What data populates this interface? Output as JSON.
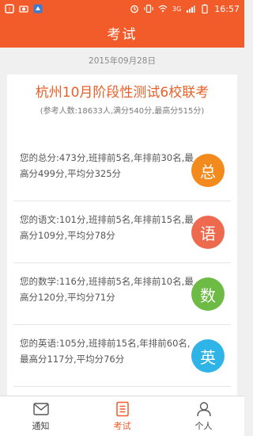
{
  "status_bar": {
    "time": "16:57",
    "signal_text": "3G"
  },
  "header": {
    "title": "考试"
  },
  "date": "2015年09月28日",
  "exam": {
    "title": "杭州10月阶段性测试6校联考",
    "meta": "(参考人数:18633人,满分540分,最高分515分)"
  },
  "scores": [
    {
      "text": "您的总分:473分,班排前5名,年排前30名,最高分499分,平均分325分",
      "badge": "总",
      "color": "#f28a1e"
    },
    {
      "text": "您的语文:101分,班排前5名,年排前15名,最高分109分,平均分78分",
      "badge": "语",
      "color": "#ee6a4f"
    },
    {
      "text": "您的数学:116分,班排前5名,年排前10名,最高分120分,平均分71分",
      "badge": "数",
      "color": "#6dbb45"
    },
    {
      "text": "您的英语:105分,班排前15名,年排前60名,最高分117分,平均分76分",
      "badge": "英",
      "color": "#2fb4e8"
    }
  ],
  "tabs": [
    {
      "label": "通知",
      "icon": "mail-icon"
    },
    {
      "label": "考试",
      "icon": "clipboard-icon"
    },
    {
      "label": "个人",
      "icon": "person-icon"
    }
  ],
  "colors": {
    "brand": "#f15c2a",
    "title": "#e8602a"
  }
}
